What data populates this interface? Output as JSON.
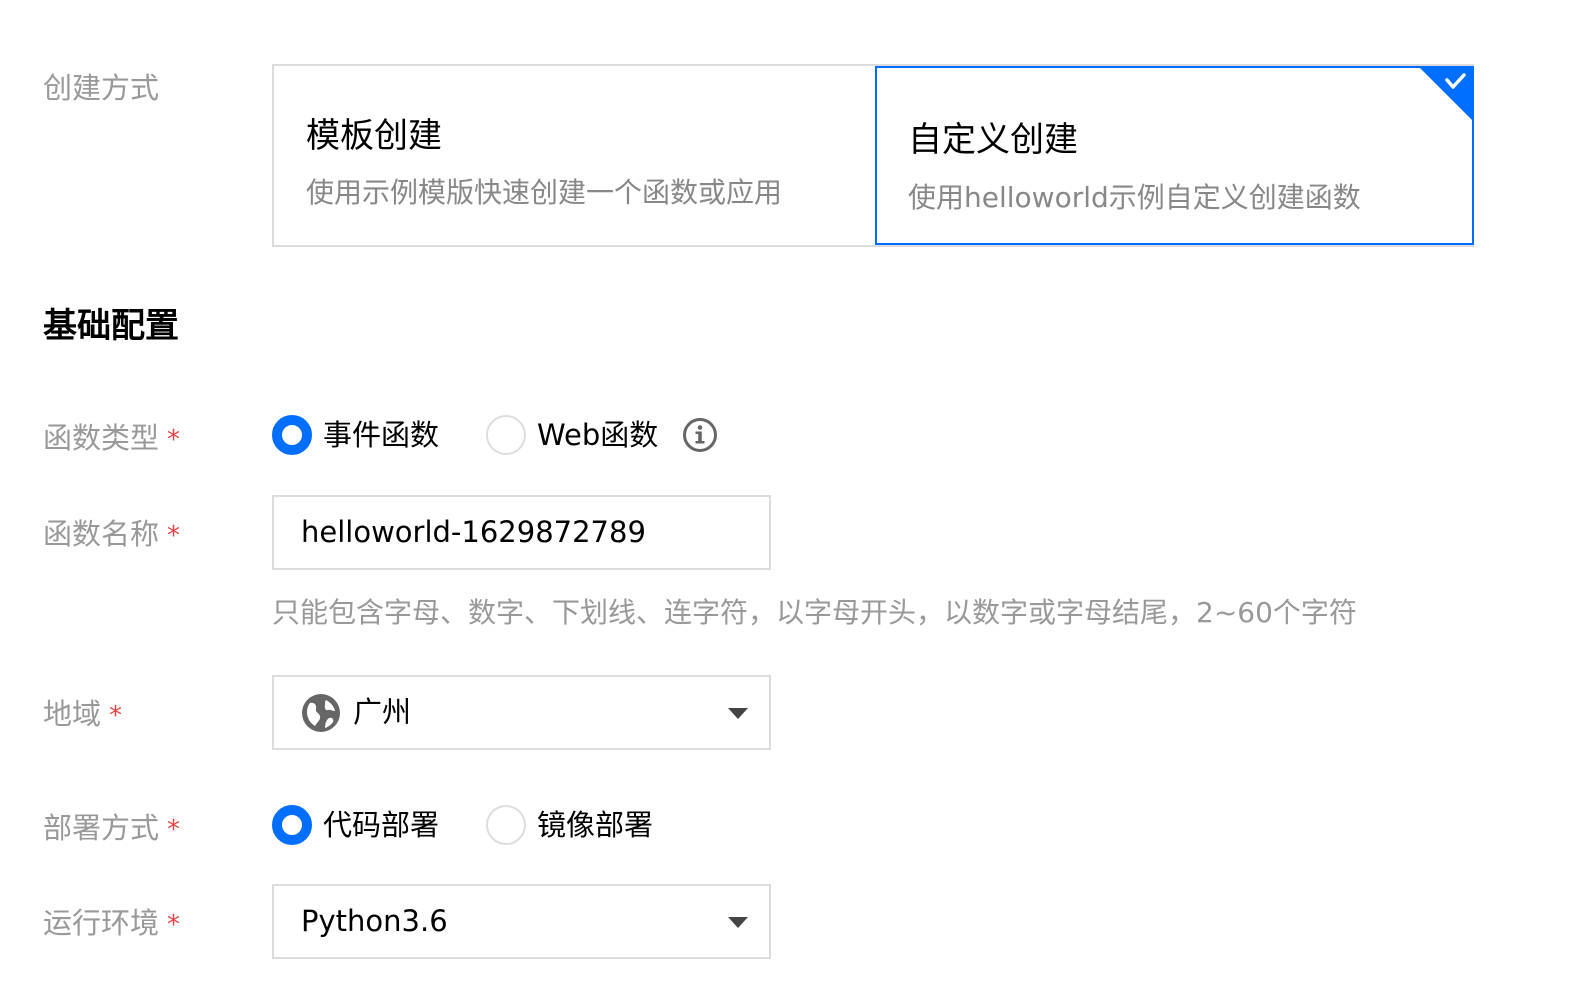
{
  "creation": {
    "label": "创建方式",
    "options": [
      {
        "title": "模板创建",
        "desc": "使用示例模版快速创建一个函数或应用",
        "selected": false
      },
      {
        "title": "自定义创建",
        "desc": "使用helloworld示例自定义创建函数",
        "selected": true
      }
    ]
  },
  "section": {
    "title": "基础配置"
  },
  "required_mark": "*",
  "function_type": {
    "label": "函数类型",
    "options": [
      {
        "label": "事件函数",
        "selected": true
      },
      {
        "label": "Web函数",
        "selected": false
      }
    ],
    "info_icon": "info-icon"
  },
  "function_name": {
    "label": "函数名称",
    "value": "helloworld-1629872789",
    "hint": "只能包含字母、数字、下划线、连字符，以字母开头，以数字或字母结尾，2~60个字符"
  },
  "region": {
    "label": "地域",
    "value": "广州",
    "icon": "globe-icon"
  },
  "deploy": {
    "label": "部署方式",
    "options": [
      {
        "label": "代码部署",
        "selected": true
      },
      {
        "label": "镜像部署",
        "selected": false
      }
    ]
  },
  "runtime": {
    "label": "运行环境",
    "value": "Python3.6"
  },
  "colors": {
    "accent": "#006eff",
    "required": "#e54545",
    "label": "#999999",
    "border": "#dcdcdc"
  }
}
